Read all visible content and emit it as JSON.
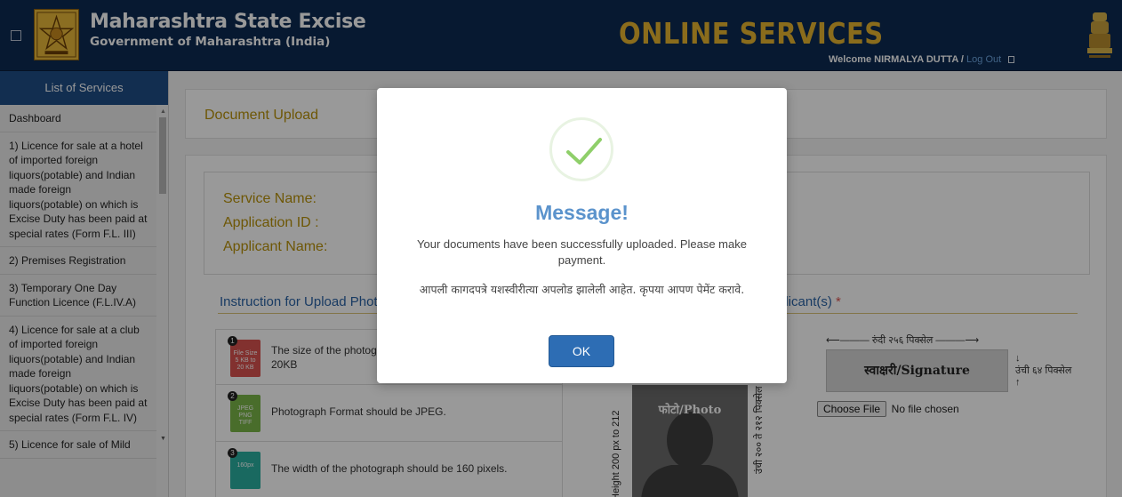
{
  "header": {
    "org_title": "Maharashtra State Excise",
    "org_subtitle": "Government of Maharashtra (India)",
    "portal_title": "ONLINE SERVICES",
    "welcome_text": "Welcome NIRMALYA DUTTA / ",
    "logout_label": "Log Out",
    "icons": [
      "menu-icon",
      "excise-logo-icon",
      "state-emblem-icon",
      "logout-icon"
    ]
  },
  "sidebar": {
    "heading": "List of Services",
    "items": [
      {
        "label": "Dashboard"
      },
      {
        "label": "1) Licence for sale at a hotel of imported foreign liquors(potable) and Indian made foreign liquors(potable) on which is Excise Duty has been paid at special rates (Form F.L. III)"
      },
      {
        "label": "2) Premises Registration"
      },
      {
        "label": "3) Temporary One Day Function Licence (F.L.IV.A)"
      },
      {
        "label": "4) Licence for sale at a club of imported foreign liquors(potable) and Indian made foreign liquors(potable) on which is Excise Duty has been paid at special rates (Form F.L. IV)"
      },
      {
        "label": "5) Licence for sale of Mild"
      }
    ]
  },
  "main": {
    "page_title": "Document Upload",
    "info_labels": {
      "service_name": "Service Name:",
      "application_id": "Application ID :",
      "applicant_name": "Applicant Name:"
    },
    "instruction_heading_left": "Instruction for Upload Photo",
    "instruction_heading_right": "plicant(s)",
    "required_star": "*",
    "instructions": [
      {
        "num": "1",
        "icon": "File Size 5 KB to 20 KB",
        "text_line1": "The size of the photogr",
        "text_line2": "20KB",
        "color": "#d9534f"
      },
      {
        "num": "2",
        "icon": "JPEG PNG TIFF",
        "text": "Photograph Format should be JPEG.",
        "color": "#7ab648"
      },
      {
        "num": "3",
        "icon": "160px",
        "text": "The width of the photograph should be 160 pixels.",
        "color": "#2ab0a0"
      }
    ],
    "photo": {
      "label": "फोटो/Photo",
      "height_left": "Height 200 px to 212",
      "height_right": "उंची २०० ते २१२ पिक्सेल"
    },
    "signature": {
      "width_label": "रुंदी २५६ पिक्सेल",
      "label": "स्वाक्षरी/Signature",
      "height_label": "उंची ६४ पिक्सेल",
      "choose_file_label": "Choose File",
      "no_file_text": "No file chosen"
    }
  },
  "modal": {
    "icon": "success-check-icon",
    "title": "Message!",
    "message_en": "Your documents have been successfully uploaded. Please make payment.",
    "message_mr": "आपली कागदपत्रे यशस्वीरीत्या अपलोड झालेली आहेत. कृपया आपण पेमेंट करावे.",
    "ok_label": "OK"
  },
  "colors": {
    "header_bg": "#0c2a52",
    "accent_gold": "#e6b52f",
    "sidebar_head": "#1f4d86",
    "modal_title": "#5b93cc",
    "ok_button": "#2d6db4",
    "success_check": "#8fcf6a"
  }
}
